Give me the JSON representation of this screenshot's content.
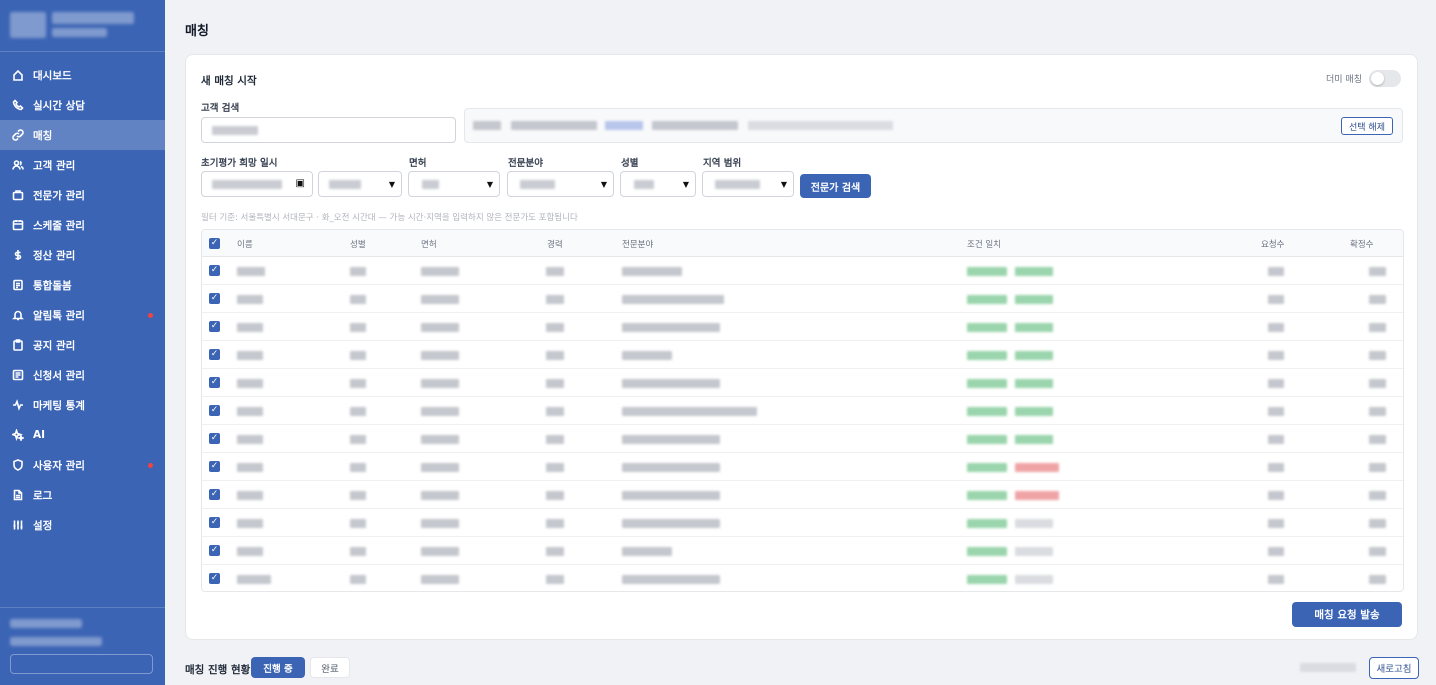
{
  "sidebar": {
    "items": [
      {
        "label": "대시보드",
        "icon": "home-icon",
        "active": false
      },
      {
        "label": "실시간 상담",
        "icon": "phone-icon",
        "active": false
      },
      {
        "label": "매칭",
        "icon": "link-icon",
        "active": true
      },
      {
        "label": "고객 관리",
        "icon": "users-icon",
        "active": false
      },
      {
        "label": "전문가 관리",
        "icon": "briefcase-icon",
        "active": false
      },
      {
        "label": "스케줄 관리",
        "icon": "calendar-icon",
        "active": false
      },
      {
        "label": "정산 관리",
        "icon": "dollar-icon",
        "active": false
      },
      {
        "label": "통합돌봄",
        "icon": "document-icon",
        "active": false
      },
      {
        "label": "알림톡 관리",
        "icon": "bell-icon",
        "active": false,
        "badge": true
      },
      {
        "label": "공지 관리",
        "icon": "clipboard-icon",
        "active": false
      },
      {
        "label": "신청서 관리",
        "icon": "form-icon",
        "active": false
      },
      {
        "label": "마케팅 통계",
        "icon": "activity-icon",
        "active": false
      },
      {
        "label": "AI",
        "icon": "sparkle-icon",
        "active": false
      },
      {
        "label": "사용자 관리",
        "icon": "shield-icon",
        "active": false,
        "badge": true
      },
      {
        "label": "로그",
        "icon": "file-icon",
        "active": false
      },
      {
        "label": "설정",
        "icon": "sliders-icon",
        "active": false
      }
    ]
  },
  "page": {
    "title": "매칭"
  },
  "new_matching": {
    "title": "새 매칭 시작",
    "dummy_label": "더미 매칭",
    "customer_search_label": "고객 검색",
    "unselect_label": "선택 해제",
    "filters": {
      "datetime_label": "초기평가 희망 일시",
      "license_label": "면허",
      "specialty_label": "전문분야",
      "gender_label": "성별",
      "region_label": "지역 범위",
      "search_button": "전문가 검색"
    },
    "filter_note": "필터 기준: 서울특별시 서대문구 · 화_오전 시간대 — 가능 시간·지역을 입력하지 않은 전문가도 포함됩니다",
    "table": {
      "headers": [
        "이름",
        "성별",
        "면허",
        "경력",
        "전문분야",
        "조건 일치",
        "요청수",
        "확정수"
      ]
    },
    "send_button": "매칭 요청 발송"
  },
  "progress": {
    "title": "매칭 진행 현황",
    "tab_active": "진행 중",
    "tab_done": "완료",
    "refresh": "새로고침"
  },
  "colors": {
    "brand": "#3b64b4",
    "match_ok": "#9ad5ad",
    "match_fail": "#f0a3a5",
    "badge": "#ef4444"
  }
}
